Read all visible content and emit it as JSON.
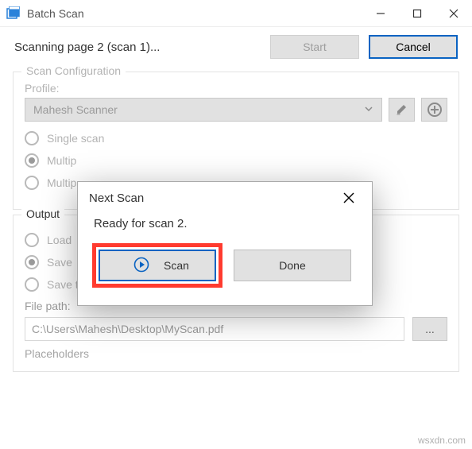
{
  "window": {
    "title": "Batch Scan"
  },
  "status": {
    "text": "Scanning page 2 (scan 1)...",
    "start_label": "Start",
    "cancel_label": "Cancel"
  },
  "config": {
    "legend": "Scan Configuration",
    "profile_label": "Profile:",
    "profile_value": "Mahesh Scanner",
    "radios": {
      "single": "Single scan",
      "multi_prompt": "Multip",
      "multi_delay": "Multip"
    }
  },
  "output": {
    "legend": "Output",
    "radios": {
      "load": "Load",
      "save_single": "Save",
      "save_multi": "Save to multiple files"
    },
    "filepath_label": "File path:",
    "filepath_value": "C:\\Users\\Mahesh\\Desktop\\MyScan.pdf",
    "browse_label": "...",
    "placeholders_label": "Placeholders"
  },
  "modal": {
    "title": "Next Scan",
    "message": "Ready for scan 2.",
    "scan_label": "Scan",
    "done_label": "Done"
  },
  "watermark": "wsxdn.com"
}
